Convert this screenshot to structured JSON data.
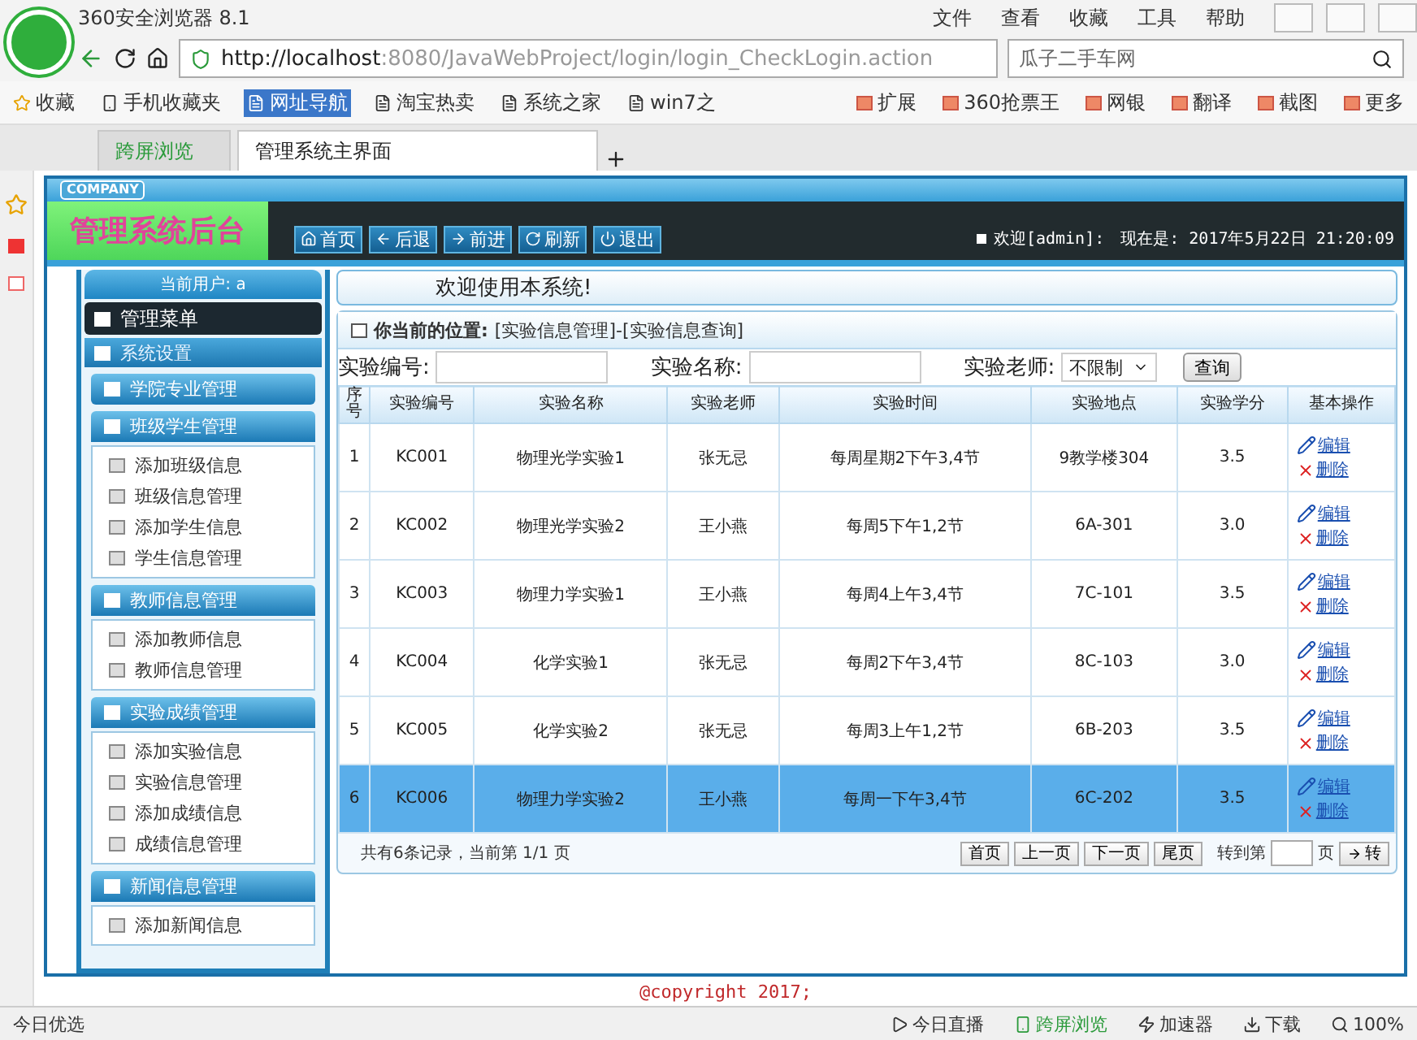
{
  "browser": {
    "title": "360安全浏览器 8.1",
    "menu": [
      "文件",
      "查看",
      "收藏",
      "工具",
      "帮助"
    ],
    "url": {
      "host": "http://localhost",
      "path": ":8080/JavaWebProject/login/login_CheckLogin.action"
    },
    "search": {
      "placeholder": "瓜子二手车网"
    },
    "bookmarks": [
      "收藏",
      "手机收藏夹",
      "网址导航",
      "淘宝热卖",
      "系统之家",
      "win7之"
    ],
    "tools": [
      "扩展",
      "360抢票王",
      "网银",
      "翻译",
      "截图",
      "更多"
    ],
    "tabs": [
      {
        "label": "跨屏浏览",
        "selected": false
      },
      {
        "label": "管理系统主界面",
        "selected": true
      }
    ]
  },
  "header": {
    "company": "COMPANY",
    "title": "管理系统后台",
    "nav": [
      "首页",
      "后退",
      "前进",
      "刷新",
      "退出"
    ],
    "welcome": "欢迎[admin]:",
    "now": "现在是: 2017年5月22日 21:20:09"
  },
  "sidebar": {
    "user": "当前用户: a",
    "menu_title": "管理菜单",
    "section": "系统设置",
    "groups": [
      {
        "title": "学院专业管理",
        "expanded": false
      },
      {
        "title": "班级学生管理",
        "expanded": true,
        "items": [
          "添加班级信息",
          "班级信息管理",
          "添加学生信息",
          "学生信息管理"
        ]
      },
      {
        "title": "教师信息管理",
        "expanded": true,
        "items": [
          "添加教师信息",
          "教师信息管理"
        ]
      },
      {
        "title": "实验成绩管理",
        "expanded": true,
        "items": [
          "添加实验信息",
          "实验信息管理",
          "添加成绩信息",
          "成绩信息管理"
        ]
      },
      {
        "title": "新闻信息管理",
        "expanded": true,
        "items": [
          "添加新闻信息"
        ]
      }
    ]
  },
  "main": {
    "welcome": "欢迎使用本系统!",
    "location_label": "你当前的位置:",
    "location": "[实验信息管理]-[实验信息查询]",
    "filters": [
      {
        "label": "实验编号:"
      },
      {
        "label": "实验名称:"
      }
    ],
    "teacher_select": {
      "label": "实验老师:",
      "value": "不限制"
    },
    "query_button": "查询",
    "table": {
      "columns": [
        "序号",
        "实验编号",
        "实验名称",
        "实验老师",
        "实验时间",
        "实验地点",
        "实验学分",
        "基本操作"
      ],
      "rows": [
        {
          "cells": [
            "1",
            "KC001",
            "物理光学实验1",
            "张无忌",
            "每周星期2下午3,4节",
            "9教学楼304",
            "3.5"
          ],
          "actions": [
            "编辑",
            "删除"
          ],
          "selected": false
        },
        {
          "cells": [
            "2",
            "KC002",
            "物理光学实验2",
            "王小燕",
            "每周5下午1,2节",
            "6A-301",
            "3.0"
          ],
          "actions": [
            "编辑",
            "删除"
          ],
          "selected": false
        },
        {
          "cells": [
            "3",
            "KC003",
            "物理力学实验1",
            "王小燕",
            "每周4上午3,4节",
            "7C-101",
            "3.5"
          ],
          "actions": [
            "编辑",
            "删除"
          ],
          "selected": false
        },
        {
          "cells": [
            "4",
            "KC004",
            "化学实验1",
            "张无忌",
            "每周2下午3,4节",
            "8C-103",
            "3.0"
          ],
          "actions": [
            "编辑",
            "删除"
          ],
          "selected": false
        },
        {
          "cells": [
            "5",
            "KC005",
            "化学实验2",
            "张无忌",
            "每周3上午1,2节",
            "6B-203",
            "3.5"
          ],
          "actions": [
            "编辑",
            "删除"
          ],
          "selected": false
        },
        {
          "cells": [
            "6",
            "KC006",
            "物理力学实验2",
            "王小燕",
            "每周一下午3,4节",
            "6C-202",
            "3.5"
          ],
          "actions": [
            "编辑",
            "删除"
          ],
          "selected": true
        }
      ]
    },
    "pager": {
      "summary": "共有6条记录，当前第 1/1 页",
      "buttons": [
        "首页",
        "上一页",
        "下一页",
        "尾页"
      ],
      "goto_label": "转到第",
      "unit": "页",
      "go": "转"
    }
  },
  "copyright": "@copyright 2017;",
  "status_bar": {
    "left": "今日优选",
    "items": [
      "今日直播",
      "跨屏浏览",
      "加速器",
      "下载"
    ],
    "zoom": "100%"
  }
}
